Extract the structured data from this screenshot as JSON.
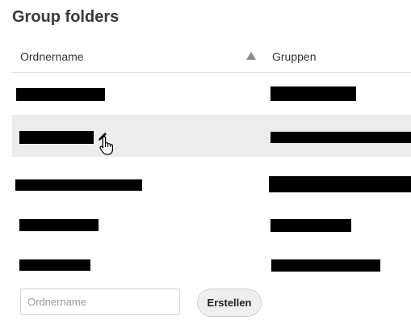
{
  "page": {
    "title": "Group folders"
  },
  "table": {
    "columns": {
      "name": "Ordnername",
      "groups": "Gruppen"
    },
    "sort": {
      "column": "name",
      "direction": "ascending"
    },
    "rows": [
      {
        "name": "",
        "groups": "",
        "name_redacted": true,
        "groups_redacted": true
      },
      {
        "name": "",
        "groups": "",
        "name_redacted": true,
        "groups_redacted": true,
        "hovered": true
      },
      {
        "name": "",
        "groups": "",
        "name_redacted": true,
        "groups_redacted": true
      },
      {
        "name": "",
        "groups": "",
        "name_redacted": true,
        "groups_redacted": true
      },
      {
        "name": "",
        "groups": "",
        "name_redacted": true,
        "groups_redacted": true
      }
    ]
  },
  "create_form": {
    "input_placeholder": "Ordnername",
    "input_value": "",
    "button_label": "Erstellen"
  },
  "icons": {
    "sort": "triangle-up-icon",
    "edit": "pencil-icon",
    "cursor": "hand-pointer-icon"
  }
}
